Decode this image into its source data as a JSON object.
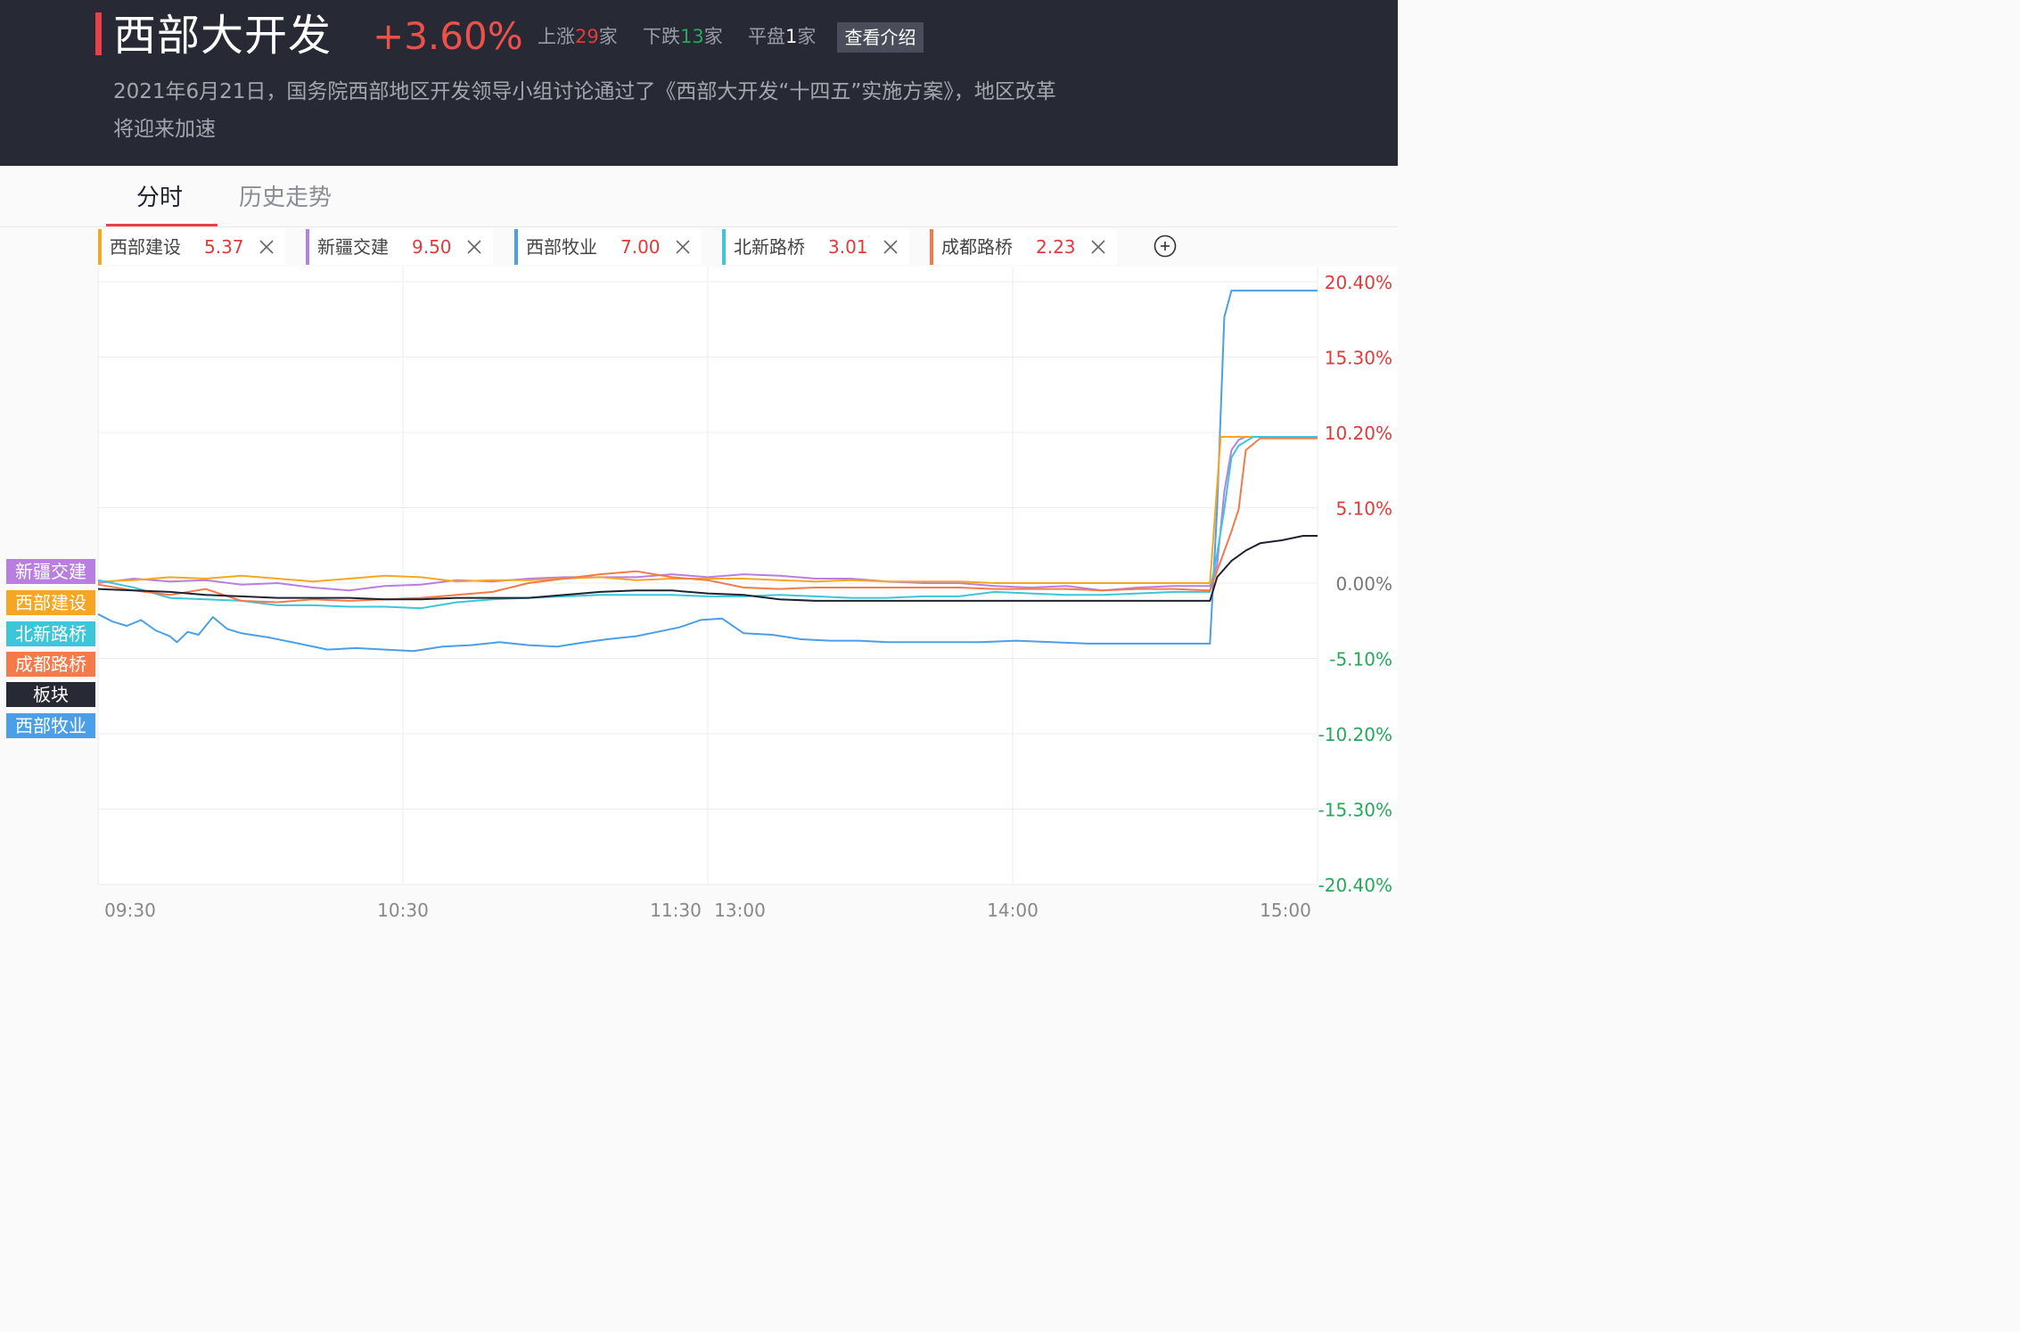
{
  "header": {
    "title": "西部大开发",
    "change_pct": "+3.60%",
    "up_label": "上涨",
    "up_count": "29",
    "down_label": "下跌",
    "down_count": "13",
    "flat_label": "平盘",
    "flat_count": "1",
    "unit": "家",
    "intro_button": "查看介绍",
    "description": "2021年6月21日，国务院西部地区开发领导小组讨论通过了《西部大开发“十四五”实施方案》，地区改革将迎来加速"
  },
  "tabs": [
    {
      "label": "分时",
      "active": true
    },
    {
      "label": "历史走势",
      "active": false
    }
  ],
  "stocks": [
    {
      "name": "西部建设",
      "value": "5.37",
      "color": "#f5a623"
    },
    {
      "name": "新疆交建",
      "value": "9.50",
      "color": "#b97fe0"
    },
    {
      "name": "西部牧业",
      "value": "7.00",
      "color": "#4a9fe8"
    },
    {
      "name": "北新路桥",
      "value": "3.01",
      "color": "#3cc6d8"
    },
    {
      "name": "成都路桥",
      "value": "2.23",
      "color": "#f47a4a"
    }
  ],
  "legend": [
    {
      "label": "新疆交建",
      "color": "#b97fe0"
    },
    {
      "label": "西部建设",
      "color": "#f5a623"
    },
    {
      "label": "北新路桥",
      "color": "#3cc6d8"
    },
    {
      "label": "成都路桥",
      "color": "#f47a4a"
    },
    {
      "label": "板块",
      "color": "#272a35"
    },
    {
      "label": "西部牧业",
      "color": "#4a9fe8"
    }
  ],
  "chart_data": {
    "type": "line",
    "xlabel": "",
    "ylabel": "",
    "x_ticks": [
      "09:30",
      "10:30",
      "11:30",
      "13:00",
      "14:00",
      "15:00"
    ],
    "y_ticks": [
      "20.40%",
      "15.30%",
      "10.20%",
      "5.10%",
      "0.00%",
      "-5.10%",
      "-10.20%",
      "-15.30%",
      "-20.40%"
    ],
    "ylim": [
      -20.4,
      20.4
    ],
    "x_unit": "trading minutes since 09:30",
    "xlim": [
      0,
      240
    ],
    "grid": true,
    "series": [
      {
        "name": "西部牧业",
        "color": "#4a9fe8",
        "points": [
          [
            0,
            -2.1
          ],
          [
            4,
            -2.6
          ],
          [
            8,
            -2.9
          ],
          [
            12,
            -2.5
          ],
          [
            16,
            -3.2
          ],
          [
            20,
            -3.6
          ],
          [
            22,
            -4.0
          ],
          [
            25,
            -3.3
          ],
          [
            28,
            -3.5
          ],
          [
            32,
            -2.3
          ],
          [
            36,
            -3.1
          ],
          [
            40,
            -3.4
          ],
          [
            48,
            -3.7
          ],
          [
            56,
            -4.1
          ],
          [
            64,
            -4.5
          ],
          [
            72,
            -4.4
          ],
          [
            80,
            -4.5
          ],
          [
            88,
            -4.6
          ],
          [
            96,
            -4.3
          ],
          [
            104,
            -4.2
          ],
          [
            112,
            -4.0
          ],
          [
            120,
            -4.2
          ],
          [
            128,
            -4.3
          ],
          [
            136,
            -4.0
          ],
          [
            142,
            -3.8
          ],
          [
            146,
            -3.7
          ],
          [
            150,
            -3.6
          ],
          [
            156,
            -3.3
          ],
          [
            162,
            -3.0
          ],
          [
            168,
            -2.5
          ],
          [
            174,
            -2.4
          ],
          [
            180,
            -3.4
          ],
          [
            188,
            -3.5
          ],
          [
            196,
            -3.8
          ],
          [
            204,
            -3.9
          ],
          [
            212,
            -3.9
          ],
          [
            220,
            -4.0
          ],
          [
            228,
            -4.0
          ],
          [
            236,
            -4.0
          ],
          [
            240,
            -4.0
          ],
          [
            246,
            -4.0
          ],
          [
            256,
            -3.9
          ],
          [
            266,
            -4.0
          ],
          [
            276,
            -4.1
          ],
          [
            286,
            -4.1
          ],
          [
            296,
            -4.1
          ],
          [
            304,
            -4.1
          ],
          [
            310,
            -4.1
          ],
          [
            312,
            5.0
          ],
          [
            314,
            18.0
          ],
          [
            316,
            19.8
          ],
          [
            320,
            19.8
          ],
          [
            330,
            19.8
          ],
          [
            340,
            19.8
          ]
        ]
      },
      {
        "name": "新疆交建",
        "color": "#b97fe0",
        "points": [
          [
            0,
            0.0
          ],
          [
            10,
            0.3
          ],
          [
            20,
            0.1
          ],
          [
            30,
            0.2
          ],
          [
            40,
            -0.1
          ],
          [
            50,
            0.0
          ],
          [
            60,
            -0.3
          ],
          [
            70,
            -0.5
          ],
          [
            80,
            -0.2
          ],
          [
            90,
            -0.1
          ],
          [
            100,
            0.2
          ],
          [
            110,
            0.1
          ],
          [
            120,
            0.3
          ],
          [
            130,
            0.4
          ],
          [
            140,
            0.4
          ],
          [
            150,
            0.4
          ],
          [
            160,
            0.6
          ],
          [
            170,
            0.4
          ],
          [
            180,
            0.6
          ],
          [
            190,
            0.5
          ],
          [
            200,
            0.3
          ],
          [
            210,
            0.3
          ],
          [
            220,
            0.1
          ],
          [
            230,
            0.0
          ],
          [
            240,
            0.0
          ],
          [
            250,
            -0.2
          ],
          [
            260,
            -0.3
          ],
          [
            270,
            -0.2
          ],
          [
            280,
            -0.5
          ],
          [
            290,
            -0.3
          ],
          [
            300,
            -0.2
          ],
          [
            310,
            -0.2
          ],
          [
            312,
            1.2
          ],
          [
            314,
            6.2
          ],
          [
            316,
            9.0
          ],
          [
            318,
            9.7
          ],
          [
            320,
            9.9
          ],
          [
            330,
            9.9
          ],
          [
            340,
            9.9
          ]
        ]
      },
      {
        "name": "西部建设",
        "color": "#f5a623",
        "points": [
          [
            0,
            0.1
          ],
          [
            10,
            0.2
          ],
          [
            20,
            0.4
          ],
          [
            30,
            0.3
          ],
          [
            40,
            0.5
          ],
          [
            50,
            0.3
          ],
          [
            60,
            0.1
          ],
          [
            70,
            0.3
          ],
          [
            80,
            0.5
          ],
          [
            90,
            0.4
          ],
          [
            100,
            0.1
          ],
          [
            110,
            0.2
          ],
          [
            120,
            0.2
          ],
          [
            130,
            0.3
          ],
          [
            140,
            0.4
          ],
          [
            150,
            0.2
          ],
          [
            160,
            0.3
          ],
          [
            170,
            0.3
          ],
          [
            180,
            0.3
          ],
          [
            190,
            0.2
          ],
          [
            200,
            0.1
          ],
          [
            210,
            0.2
          ],
          [
            220,
            0.1
          ],
          [
            230,
            0.1
          ],
          [
            240,
            0.1
          ],
          [
            250,
            0.0
          ],
          [
            260,
            0.0
          ],
          [
            270,
            0.0
          ],
          [
            280,
            0.0
          ],
          [
            290,
            0.0
          ],
          [
            300,
            0.0
          ],
          [
            310,
            0.0
          ],
          [
            313,
            9.9
          ],
          [
            316,
            9.9
          ],
          [
            320,
            9.9
          ],
          [
            330,
            9.9
          ],
          [
            340,
            9.9
          ]
        ]
      },
      {
        "name": "北新路桥",
        "color": "#3cc6d8",
        "points": [
          [
            0,
            0.2
          ],
          [
            10,
            -0.3
          ],
          [
            20,
            -1.0
          ],
          [
            30,
            -1.1
          ],
          [
            40,
            -1.2
          ],
          [
            50,
            -1.5
          ],
          [
            60,
            -1.5
          ],
          [
            70,
            -1.6
          ],
          [
            80,
            -1.6
          ],
          [
            90,
            -1.7
          ],
          [
            100,
            -1.3
          ],
          [
            110,
            -1.1
          ],
          [
            120,
            -1.0
          ],
          [
            130,
            -0.9
          ],
          [
            140,
            -0.8
          ],
          [
            150,
            -0.8
          ],
          [
            160,
            -0.8
          ],
          [
            170,
            -0.9
          ],
          [
            180,
            -0.9
          ],
          [
            190,
            -0.8
          ],
          [
            200,
            -0.9
          ],
          [
            210,
            -1.0
          ],
          [
            220,
            -1.0
          ],
          [
            230,
            -0.9
          ],
          [
            240,
            -0.9
          ],
          [
            250,
            -0.6
          ],
          [
            260,
            -0.7
          ],
          [
            270,
            -0.8
          ],
          [
            280,
            -0.8
          ],
          [
            290,
            -0.7
          ],
          [
            300,
            -0.6
          ],
          [
            310,
            -0.6
          ],
          [
            312,
            2.0
          ],
          [
            314,
            5.0
          ],
          [
            316,
            8.5
          ],
          [
            318,
            9.3
          ],
          [
            322,
            9.9
          ],
          [
            330,
            9.9
          ],
          [
            340,
            9.9
          ]
        ]
      },
      {
        "name": "成都路桥",
        "color": "#f47a4a",
        "points": [
          [
            0,
            -0.1
          ],
          [
            10,
            -0.5
          ],
          [
            20,
            -0.8
          ],
          [
            30,
            -0.4
          ],
          [
            40,
            -1.2
          ],
          [
            50,
            -1.3
          ],
          [
            60,
            -1.1
          ],
          [
            70,
            -1.2
          ],
          [
            80,
            -1.1
          ],
          [
            90,
            -1.0
          ],
          [
            100,
            -0.8
          ],
          [
            110,
            -0.6
          ],
          [
            120,
            0.0
          ],
          [
            130,
            0.3
          ],
          [
            140,
            0.6
          ],
          [
            150,
            0.8
          ],
          [
            160,
            0.4
          ],
          [
            170,
            0.2
          ],
          [
            180,
            -0.3
          ],
          [
            190,
            -0.4
          ],
          [
            200,
            -0.3
          ],
          [
            210,
            -0.3
          ],
          [
            220,
            -0.3
          ],
          [
            230,
            -0.3
          ],
          [
            240,
            -0.3
          ],
          [
            250,
            -0.4
          ],
          [
            260,
            -0.4
          ],
          [
            270,
            -0.4
          ],
          [
            280,
            -0.5
          ],
          [
            290,
            -0.4
          ],
          [
            300,
            -0.4
          ],
          [
            310,
            -0.5
          ],
          [
            313,
            1.5
          ],
          [
            316,
            3.5
          ],
          [
            318,
            5.0
          ],
          [
            320,
            9.0
          ],
          [
            324,
            9.8
          ],
          [
            330,
            9.8
          ],
          [
            340,
            9.8
          ]
        ]
      },
      {
        "name": "板块",
        "color": "#1f2230",
        "points": [
          [
            0,
            -0.4
          ],
          [
            10,
            -0.5
          ],
          [
            20,
            -0.6
          ],
          [
            30,
            -0.8
          ],
          [
            40,
            -0.9
          ],
          [
            50,
            -1.0
          ],
          [
            60,
            -1.0
          ],
          [
            70,
            -1.0
          ],
          [
            80,
            -1.1
          ],
          [
            90,
            -1.1
          ],
          [
            100,
            -1.0
          ],
          [
            110,
            -1.0
          ],
          [
            120,
            -1.0
          ],
          [
            130,
            -0.8
          ],
          [
            140,
            -0.6
          ],
          [
            150,
            -0.5
          ],
          [
            160,
            -0.5
          ],
          [
            170,
            -0.7
          ],
          [
            180,
            -0.8
          ],
          [
            190,
            -1.1
          ],
          [
            200,
            -1.2
          ],
          [
            210,
            -1.2
          ],
          [
            220,
            -1.2
          ],
          [
            230,
            -1.2
          ],
          [
            240,
            -1.2
          ],
          [
            250,
            -1.2
          ],
          [
            260,
            -1.2
          ],
          [
            270,
            -1.2
          ],
          [
            280,
            -1.2
          ],
          [
            290,
            -1.2
          ],
          [
            300,
            -1.2
          ],
          [
            310,
            -1.2
          ],
          [
            312,
            0.4
          ],
          [
            316,
            1.5
          ],
          [
            320,
            2.2
          ],
          [
            324,
            2.7
          ],
          [
            330,
            2.9
          ],
          [
            336,
            3.2
          ],
          [
            340,
            3.2
          ]
        ]
      }
    ]
  }
}
